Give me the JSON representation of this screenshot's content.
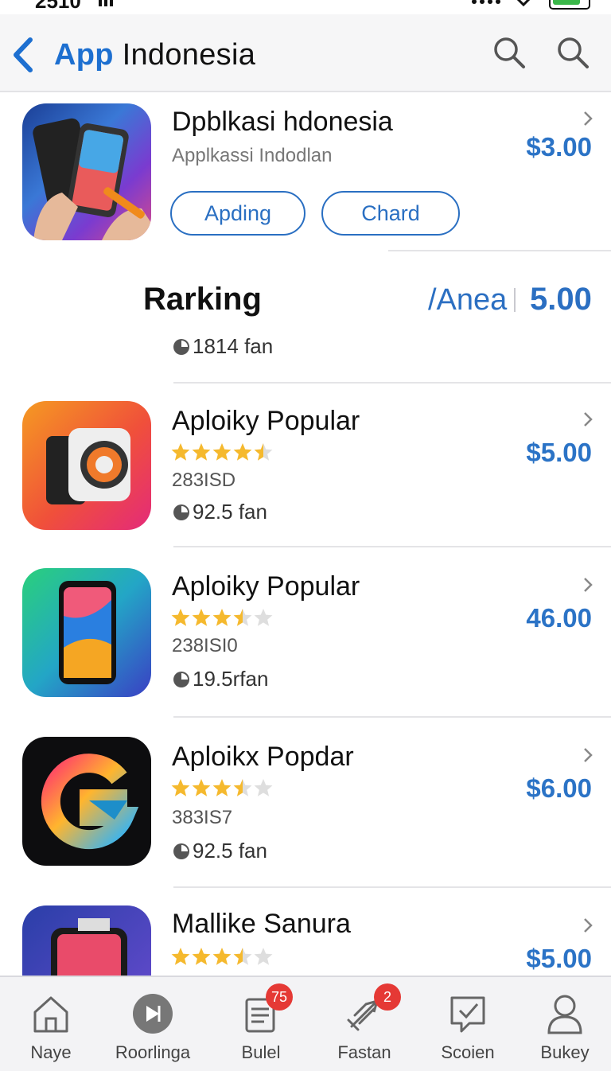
{
  "status": {
    "time": "2510"
  },
  "header": {
    "title_accent": "App",
    "title_rest": " Indonesia"
  },
  "featured": {
    "title": "Dpblkasi hdonesia",
    "subtitle": "Applkassi Indodlan",
    "price": "$3.00",
    "buttons": [
      "Apding",
      "Chard"
    ]
  },
  "ranking": {
    "title": "Rarking",
    "area": "/Anea",
    "score": "5.00",
    "fans": "1814 fan"
  },
  "apps": [
    {
      "title": "Aploiky Popular",
      "rating": 4.5,
      "meta": "283ISD",
      "fans": "92.5 fan",
      "price": "$5.00"
    },
    {
      "title": "Aploiky Popular",
      "rating": 3.5,
      "meta": "238ISI0",
      "fans": "19.5rfan",
      "price": "46.00"
    },
    {
      "title": "Aploikx Popdar",
      "rating": 3.5,
      "meta": "383IS7",
      "fans": "92.5 fan",
      "price": "$6.00"
    },
    {
      "title": "Mallike Sanura",
      "rating": 3.5,
      "meta": "",
      "fans": "",
      "price": "$5.00"
    }
  ],
  "tabs": [
    {
      "label": "Naye",
      "icon": "home-icon"
    },
    {
      "label": "Roorlinga",
      "icon": "play-circle-icon"
    },
    {
      "label": "Bulel",
      "icon": "list-icon",
      "badge": "75"
    },
    {
      "label": "Fastan",
      "icon": "rocket-icon",
      "badge": "2"
    },
    {
      "label": "Scoien",
      "icon": "chat-check-icon"
    },
    {
      "label": "Bukey",
      "icon": "person-icon"
    }
  ],
  "colors": {
    "accent": "#2b73c6",
    "star": "#f5b92e",
    "badge": "#e53935"
  }
}
